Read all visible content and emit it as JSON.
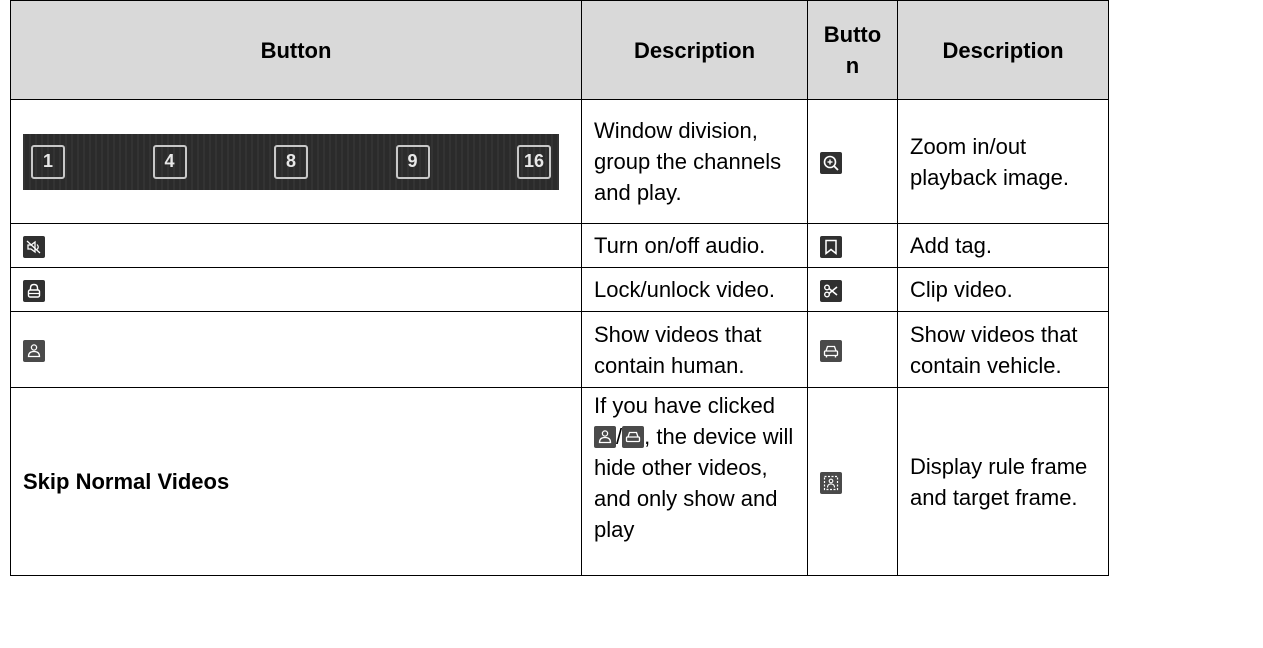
{
  "headers": {
    "button_1": "Button",
    "description_1": "Description",
    "button_2": "Button",
    "description_2": "Description"
  },
  "rows": [
    {
      "left_icons": [
        "1",
        "4",
        "8",
        "9",
        "16"
      ],
      "left_desc": "Window division, group the channels and play.",
      "right_icon": "zoom-icon",
      "right_desc": "Zoom in/out playback image."
    },
    {
      "left_icon": "audio-icon",
      "left_desc": "Turn on/off audio.",
      "right_icon": "tag-icon",
      "right_desc": "Add tag."
    },
    {
      "left_icon": "lock-icon",
      "left_desc": "Lock/unlock video.",
      "right_icon": "scissors-icon",
      "right_desc": "Clip video."
    },
    {
      "left_icon": "human-icon",
      "left_desc": "Show videos that contain human.",
      "right_icon": "vehicle-icon",
      "right_desc": "Show videos that contain vehicle."
    },
    {
      "left_label": "Skip Normal Videos",
      "left_desc_prefix": "If you have clicked",
      "left_desc_sep": "/",
      "left_desc_suffix": ", the device will hide other videos, and only show and play",
      "right_icon": "rule-frame-icon",
      "right_desc": "Display rule frame and target frame."
    }
  ]
}
